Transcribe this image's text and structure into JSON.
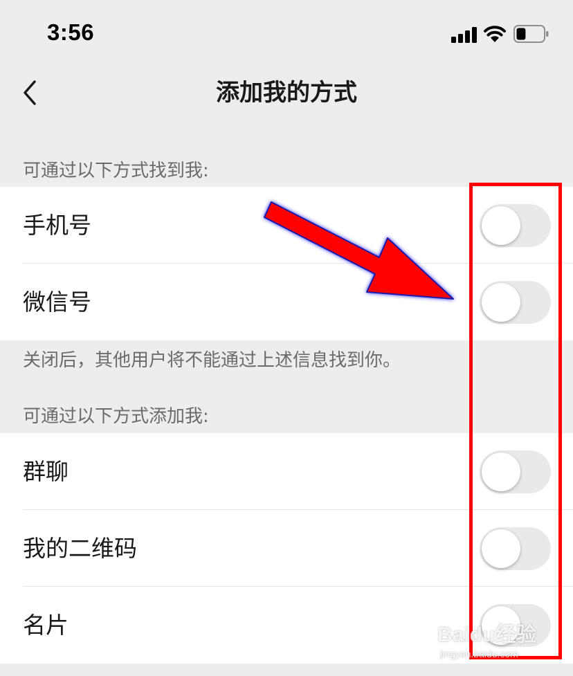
{
  "status_bar": {
    "time": "3:56",
    "signal_icon": "cellular-signal-icon",
    "wifi_icon": "wifi-icon",
    "battery_icon": "battery-icon",
    "battery_level": 0.35
  },
  "nav": {
    "back_icon": "chevron-left-icon",
    "title": "添加我的方式"
  },
  "find_section": {
    "header": "可通过以下方式找到我:",
    "items": [
      {
        "label": "手机号",
        "enabled": false
      },
      {
        "label": "微信号",
        "enabled": false
      }
    ],
    "note": "关闭后，其他用户将不能通过上述信息找到你。"
  },
  "add_section": {
    "header": "可通过以下方式添加我:",
    "items": [
      {
        "label": "群聊",
        "enabled": false
      },
      {
        "label": "我的二维码",
        "enabled": false
      },
      {
        "label": "名片",
        "enabled": false
      }
    ]
  },
  "annotations": {
    "highlight_color": "#ff0000",
    "arrow_color": "#ff0000"
  },
  "watermark": {
    "main": "Baidu经验",
    "sub": "jingyan.baidu.com"
  }
}
